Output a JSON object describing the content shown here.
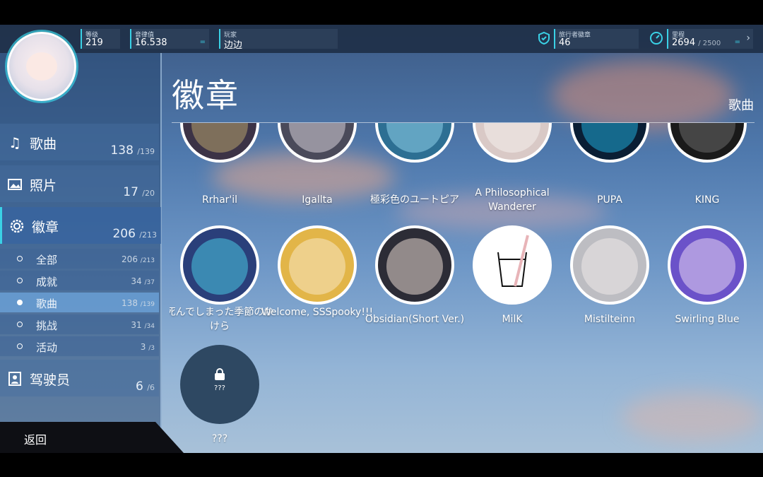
{
  "topbar": {
    "level": {
      "label": "等级",
      "value": "219"
    },
    "rks": {
      "label": "音律值",
      "value": "16.538",
      "icon": "equals-icon"
    },
    "player": {
      "label": "玩家",
      "value": "边边"
    },
    "traveler_badges": {
      "label": "旅行者徽章",
      "value": "46"
    },
    "mileage": {
      "label": "里程",
      "value": "2694",
      "max": "/ 2500"
    }
  },
  "sidebar": {
    "items": [
      {
        "label": "歌曲",
        "count": "138",
        "total": "/139",
        "icon": "music-note-icon"
      },
      {
        "label": "照片",
        "count": "17",
        "total": "/20",
        "icon": "image-icon"
      },
      {
        "label": "徽章",
        "count": "206",
        "total": "/213",
        "icon": "gear-badge-icon"
      },
      {
        "label": "驾驶员",
        "count": "6",
        "total": "/6",
        "icon": "portrait-icon"
      }
    ],
    "subitems": [
      {
        "label": "全部",
        "count": "206",
        "total": "/213"
      },
      {
        "label": "成就",
        "count": "34",
        "total": "/37"
      },
      {
        "label": "歌曲",
        "count": "138",
        "total": "/139"
      },
      {
        "label": "挑战",
        "count": "31",
        "total": "/34"
      },
      {
        "label": "活动",
        "count": "3",
        "total": "/3"
      }
    ],
    "back_label": "返回"
  },
  "main": {
    "title": "徽章",
    "filter_label": "歌曲",
    "badges_row1": [
      "Rrhar'il",
      "Igallta",
      "極彩色のユートピア",
      "A Philosophical Wanderer",
      "PUPA",
      "KING"
    ],
    "badges_row2": [
      "死んでしまった季節のかけら",
      "Welcome, SSSpooky!!!",
      "Obsidian(Short Ver.)",
      "MilK",
      "Mistilteinn",
      "Swirling Blue"
    ],
    "locked_badge": {
      "inner": "???",
      "label": "???"
    }
  },
  "colors": {
    "accent": "#3ad1e6",
    "locked": "#2e4862"
  }
}
